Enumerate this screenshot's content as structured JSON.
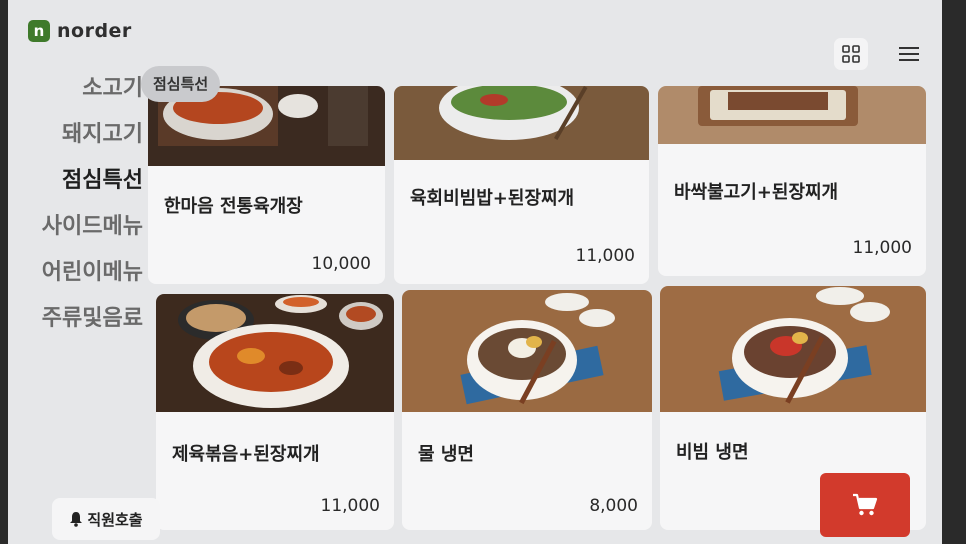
{
  "brand": {
    "logo_letter": "n",
    "name": "norder"
  },
  "top_icons": [
    "grid-view-icon",
    "hamburger-menu-icon"
  ],
  "sidebar": {
    "items": [
      {
        "label": "소고기",
        "active": false
      },
      {
        "label": "돼지고기",
        "active": false
      },
      {
        "label": "점심특선",
        "active": true
      },
      {
        "label": "사이드메뉴",
        "active": false
      },
      {
        "label": "어린이메뉴",
        "active": false
      },
      {
        "label": "주류및음료",
        "active": false
      }
    ]
  },
  "subtab": {
    "label": "점심특선"
  },
  "menu": [
    {
      "name": "한마음 전통육개장",
      "price": "10,000"
    },
    {
      "name": "육회비빔밥+된장찌개",
      "price": "11,000"
    },
    {
      "name": "바싹불고기+된장찌개",
      "price": "11,000"
    },
    {
      "name": "제육볶음+된장찌개",
      "price": "11,000"
    },
    {
      "name": "물 냉면",
      "price": "8,000"
    },
    {
      "name": "비빔 냉면",
      "price": ""
    }
  ],
  "staff_call": {
    "label": "직원호출",
    "icon": "bell-icon"
  },
  "cart": {
    "icon": "cart-icon",
    "color": "#d23a2c"
  },
  "colors": {
    "accent": "#d23a2c",
    "brand": "#3f7a2b"
  }
}
